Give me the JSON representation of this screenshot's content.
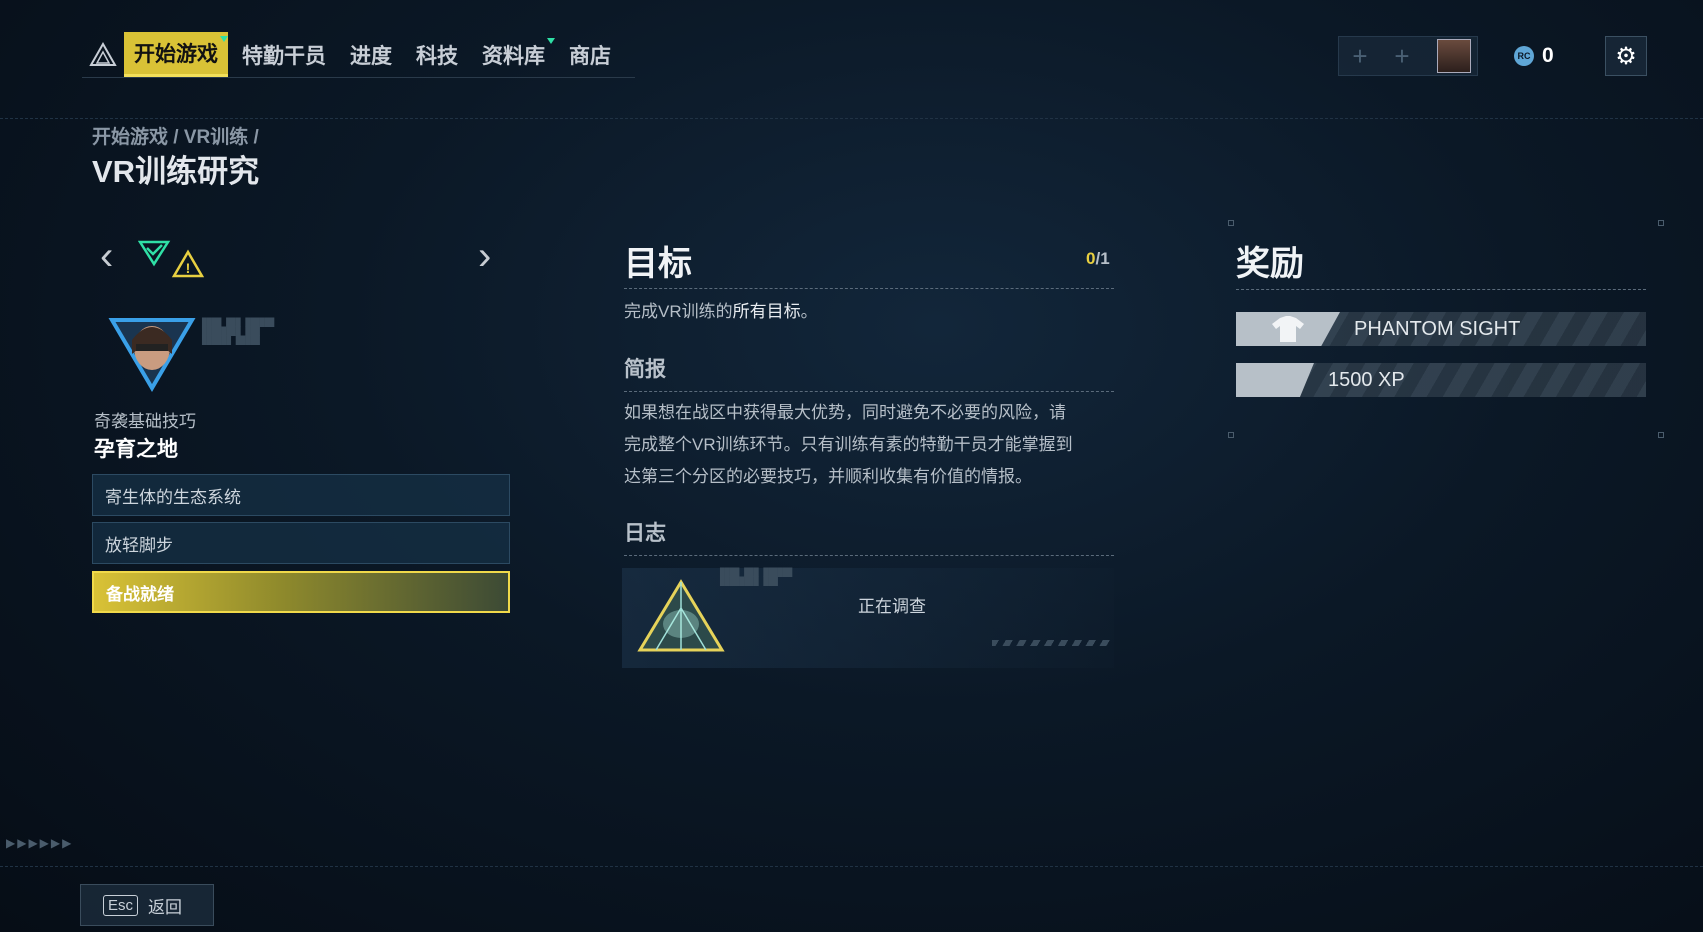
{
  "nav": {
    "items": [
      {
        "label": "开始游戏",
        "active": true,
        "dot": true
      },
      {
        "label": "特勤干员",
        "active": false,
        "dot": false
      },
      {
        "label": "进度",
        "active": false,
        "dot": false
      },
      {
        "label": "科技",
        "active": false,
        "dot": false
      },
      {
        "label": "资料库",
        "active": false,
        "dot": true
      },
      {
        "label": "商店",
        "active": false,
        "dot": false
      }
    ]
  },
  "currency": {
    "icon": "RC",
    "amount": "0"
  },
  "breadcrumb": "开始游戏 / VR训练 /",
  "page_title": "VR训练研究",
  "mission": {
    "category": "奇袭基础技巧",
    "name": "孕育之地",
    "stages": [
      "寄生体的生态系统",
      "放轻脚步",
      "备战就绪"
    ]
  },
  "objective": {
    "title": "目标",
    "progress_done": "0",
    "progress_total": "/1",
    "text_prefix": "完成VR训练的",
    "text_highlight": "所有目标",
    "text_suffix": "。"
  },
  "briefing": {
    "title": "简报",
    "lines": [
      "如果想在战区中获得最大优势，同时避免不必要的风险，请",
      "完成整个VR训练环节。只有训练有素的特勤干员才能掌握到",
      "达第三个分区的必要技巧，并顺利收集有价值的情报。"
    ]
  },
  "log": {
    "title": "日志",
    "status": "正在调查"
  },
  "rewards": {
    "title": "奖励",
    "items": [
      {
        "label": "PHANTOM SIGHT",
        "icon": "shirt-icon"
      },
      {
        "label": "1500 XP",
        "icon": "xp-icon"
      }
    ]
  },
  "footer": {
    "key": "Esc",
    "label": "返回"
  },
  "colors": {
    "accent": "#d9c236",
    "new_dot": "#2fe0a6",
    "background": "#0b1826"
  }
}
